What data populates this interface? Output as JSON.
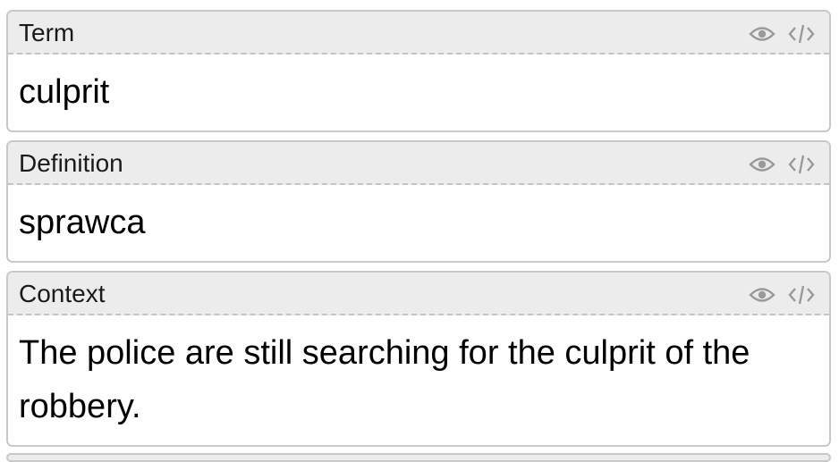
{
  "fields": [
    {
      "label": "Term",
      "value": "culprit"
    },
    {
      "label": "Definition",
      "value": "sprawca"
    },
    {
      "label": "Context",
      "value": "The police are still searching for the culprit of the robbery."
    }
  ],
  "icons": {
    "toggle_preview": "eye-icon",
    "toggle_html": "code-icon"
  },
  "colors": {
    "header_bg": "#ececec",
    "border": "#c8c8c8",
    "icon": "#9a9a9a"
  }
}
